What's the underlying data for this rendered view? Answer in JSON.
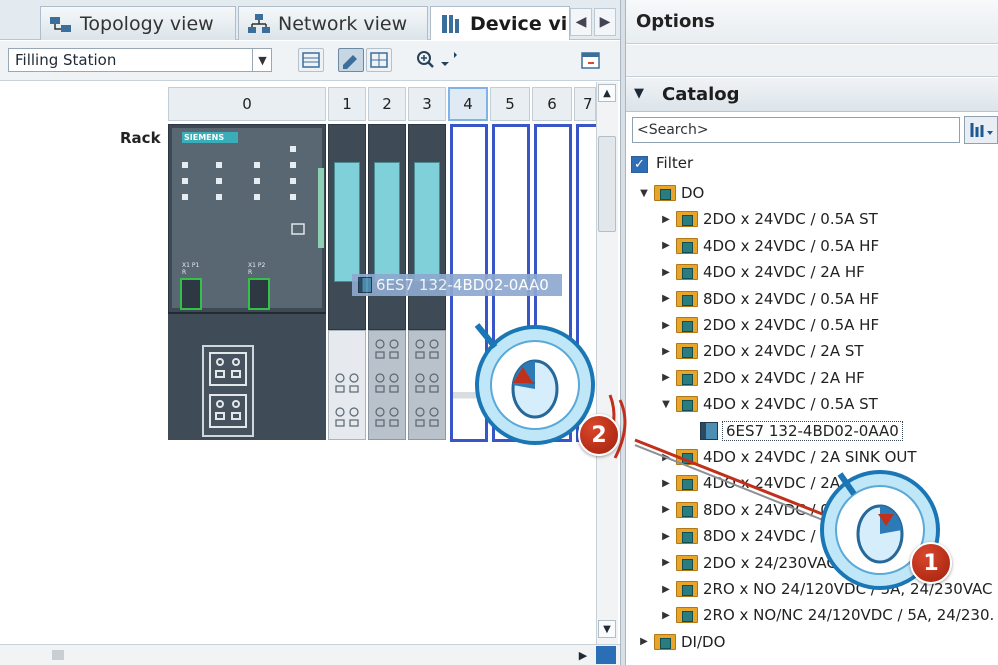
{
  "tabs": [
    {
      "label": "Topology view",
      "icon": "topology-icon"
    },
    {
      "label": "Network view",
      "icon": "network-icon"
    },
    {
      "label": "Device vi",
      "icon": "device-icon",
      "active": true
    }
  ],
  "toolbar": {
    "device_select": "Filling Station"
  },
  "slots": [
    "0",
    "1",
    "2",
    "3",
    "4",
    "5",
    "6",
    "7"
  ],
  "rack": {
    "label": "Rack"
  },
  "plc": {
    "brand": "SIEMENS",
    "port1": "X1 P1 R",
    "port2": "X1 P2 R"
  },
  "drag": {
    "label": "6ES7 132-4BD02-0AA0"
  },
  "options": {
    "title": "Options"
  },
  "catalog": {
    "title": "Catalog",
    "search_placeholder": "<Search>",
    "filter_label": "Filter",
    "tree": [
      {
        "label": "DO",
        "level": 0,
        "expanded": true
      },
      {
        "label": "2DO x 24VDC / 0.5A ST",
        "level": 1
      },
      {
        "label": "4DO x 24VDC / 0.5A HF",
        "level": 1
      },
      {
        "label": "4DO x 24VDC / 2A HF",
        "level": 1
      },
      {
        "label": "8DO x 24VDC / 0.5A HF",
        "level": 1
      },
      {
        "label": "2DO x 24VDC / 0.5A HF",
        "level": 1
      },
      {
        "label": "2DO x 24VDC / 2A ST",
        "level": 1
      },
      {
        "label": "2DO x 24VDC / 2A HF",
        "level": 1
      },
      {
        "label": "4DO x 24VDC / 0.5A ST",
        "level": 1,
        "expanded": true
      },
      {
        "label": "6ES7 132-4BD02-0AA0",
        "level": 2,
        "selected": true
      },
      {
        "label": "4DO x 24VDC / 2A SINK OUT",
        "level": 1
      },
      {
        "label": "4DO x 24VDC / 2A",
        "level": 1
      },
      {
        "label": "8DO x 24VDC / 0.5A",
        "level": 1
      },
      {
        "label": "8DO x 24VDC / 0.5A ST",
        "level": 1
      },
      {
        "label": "2DO x 24/230VAC",
        "level": 1
      },
      {
        "label": "2RO x NO 24/120VDC / 5A, 24/230VAC",
        "level": 1
      },
      {
        "label": "2RO x NO/NC 24/120VDC / 5A, 24/230.",
        "level": 1
      },
      {
        "label": "DI/DO",
        "level": 0
      }
    ]
  },
  "steps": {
    "one": "1",
    "two": "2"
  },
  "colors": {
    "accent_blue": "#3a55c8",
    "module_cyan": "#7fd0d8",
    "badge_red": "#c0301a"
  }
}
